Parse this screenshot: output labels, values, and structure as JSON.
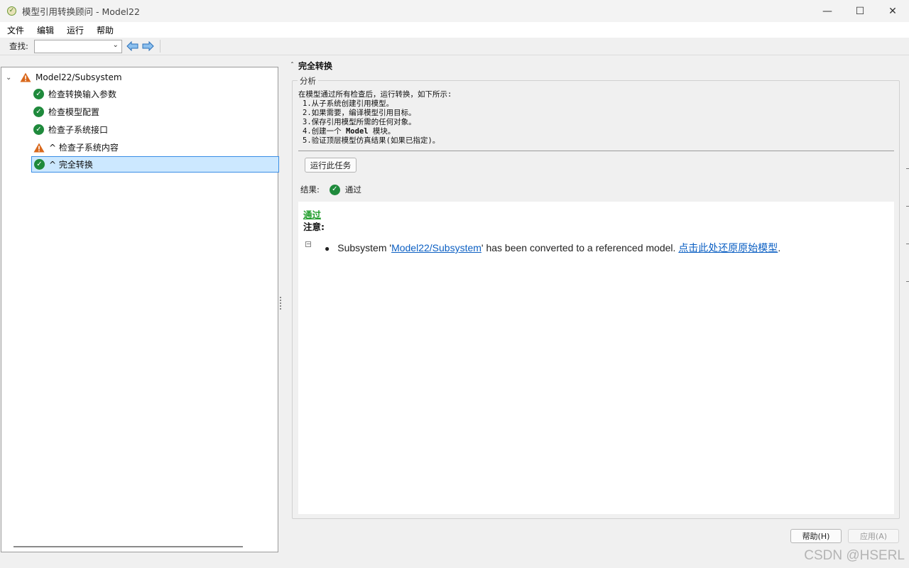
{
  "window": {
    "title": "模型引用转换顾问 - Model22",
    "controls": {
      "minimize": "—",
      "maximize": "☐",
      "close": "✕"
    }
  },
  "menu": [
    "文件",
    "编辑",
    "运行",
    "帮助"
  ],
  "toolbar": {
    "find_label": "查找:",
    "find_value": ""
  },
  "tree": {
    "root": "Model22/Subsystem",
    "items": [
      {
        "label": "检查转换输入参数",
        "status": "pass"
      },
      {
        "label": "检查模型配置",
        "status": "pass"
      },
      {
        "label": "检查子系统接口",
        "status": "pass"
      },
      {
        "label": "^ 检查子系统内容",
        "status": "warning"
      },
      {
        "label": "^ 完全转换",
        "status": "pass",
        "selected": true
      }
    ]
  },
  "details": {
    "title": "完全转换",
    "group_label": "分析",
    "analysis_intro": "在模型通过所有检查后，运行转换，如下所示:",
    "steps": [
      "1.从子系统创建引用模型。",
      "2.如果需要，编译模型引用目标。",
      "3.保存引用模型所需的任何对象。",
      "4.创建一个",
      "5.验证顶层模型仿真结果(如果已指定)。"
    ],
    "step4_bold": "Model",
    "step4_tail": " 模块。",
    "run_button": "运行此任务",
    "result_label": "结果:",
    "result_value": "通过",
    "report": {
      "pass_heading": "通过",
      "note_heading": "注意:",
      "bullet_prefix": "Subsystem '",
      "bullet_link": "Model22/Subsystem",
      "bullet_middle": "' has been converted to a referenced model. ",
      "restore_link": "点击此处还原原始模型",
      "bullet_end": "."
    }
  },
  "buttons": {
    "help": "帮助(H)",
    "apply": "应用(A)"
  },
  "watermark": "CSDN @HSERL",
  "colors": {
    "pass_green": "#1f8a3c",
    "warning_orange": "#d9681c",
    "link_blue": "#0b5fc3",
    "selection": "#cce8ff"
  }
}
